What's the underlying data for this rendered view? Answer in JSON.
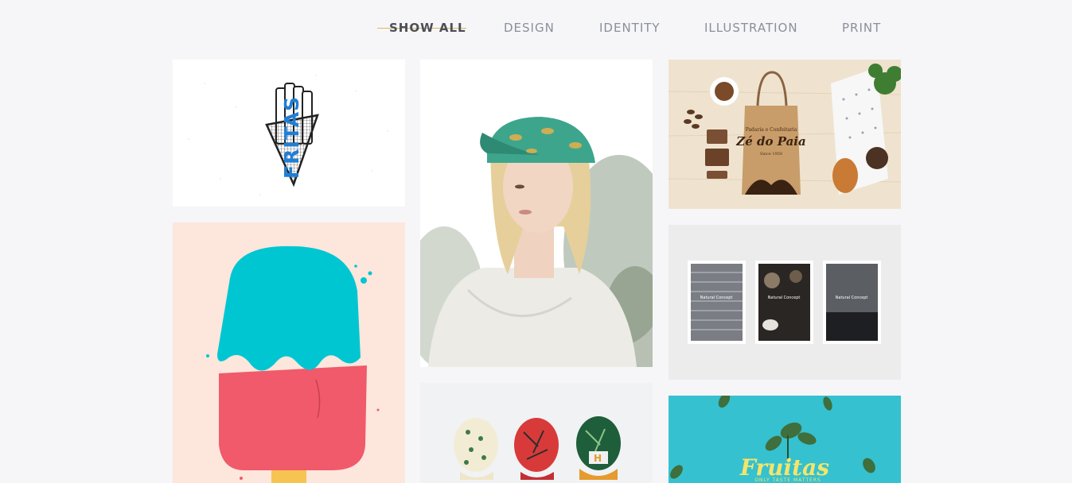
{
  "filters": [
    {
      "label": "SHOW ALL",
      "active": true
    },
    {
      "label": "DESIGN",
      "active": false
    },
    {
      "label": "IDENTITY",
      "active": false
    },
    {
      "label": "ILLUSTRATION",
      "active": false
    },
    {
      "label": "PRINT",
      "active": false
    }
  ],
  "portfolio": {
    "fritas": {
      "text": "FRITAS",
      "color": "#1f7fd6"
    },
    "bakery": {
      "line1": "Padaria e Confeitaria",
      "line2": "Zé do Paia",
      "line3": "Since 1950"
    },
    "brochure": {
      "card1": "Natural Concept",
      "card2": "Natural Concept",
      "card3": "Natural Concept"
    },
    "fruitas": {
      "title": "Fruitas",
      "subtitle": "ONLY TASTE MATTERS",
      "background": "#35c1d0"
    },
    "popsicle": {
      "background": "#fde6dc",
      "top": "#00c6d2",
      "middle": "#f05a6b",
      "stick": "#f6c451"
    }
  },
  "accent_line_color": "#e3b55a"
}
